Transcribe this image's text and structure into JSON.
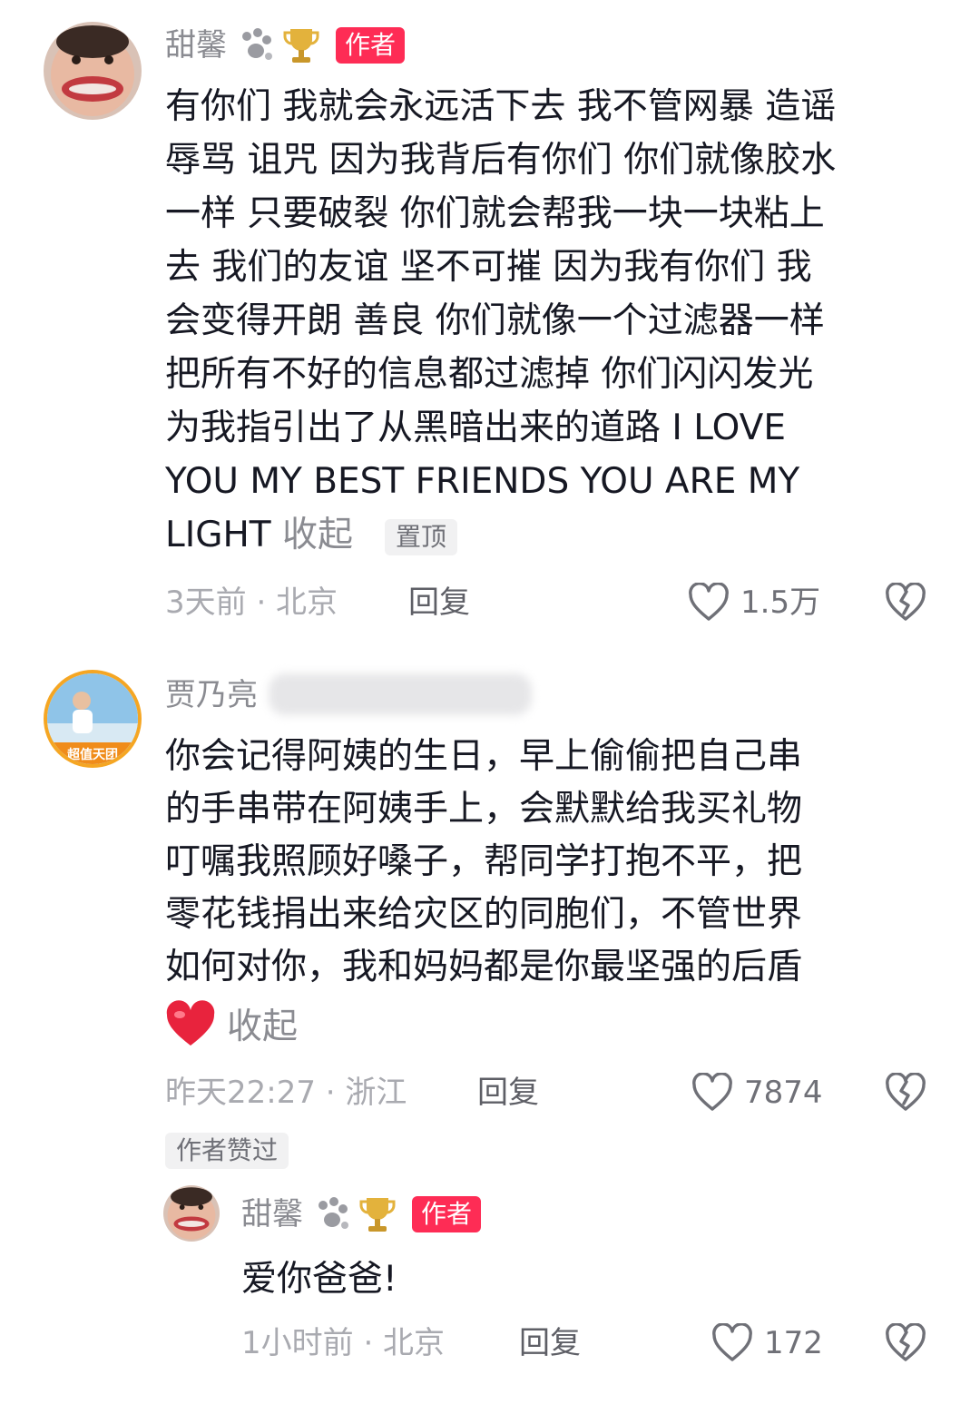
{
  "comment1": {
    "username": "甜馨",
    "author_badge": "作者",
    "lines": [
      "有你们 我就会永远活下去 我不管网暴 造谣",
      "辱骂 诅咒 因为我背后有你们 你们就像胶水",
      "一样 只要破裂 你们就会帮我一块一块粘上",
      "去 我们的友谊 坚不可摧 因为我有你们 我",
      "会变得开朗 善良 你们就像一个过滤器一样",
      "把所有不好的信息都过滤掉 你们闪闪发光",
      "为我指引出了从黑暗出来的道路 I LOVE",
      "YOU MY BEST FRIENDS YOU ARE MY"
    ],
    "last_line": "LIGHT",
    "collapse_label": "收起",
    "pinned_label": "置顶",
    "time_location": "3天前 · 北京",
    "reply_label": "回复",
    "like_count": "1.5万"
  },
  "comment2": {
    "username": "贾乃亮",
    "lines": [
      "你会记得阿姨的生日，早上偷偷把自己串",
      "的手串带在阿姨手上，会默默给我买礼物",
      "叮嘱我照顾好嗓子，帮同学打抱不平，把",
      "零花钱捐出来给灾区的同胞们，不管世界",
      "如何对你，我和妈妈都是你最坚强的后盾"
    ],
    "collapse_label": "收起",
    "time_location": "昨天22:27 · 浙江",
    "reply_label": "回复",
    "like_count": "7874",
    "author_liked_label": "作者赞过"
  },
  "reply1": {
    "username": "甜馨",
    "author_badge": "作者",
    "text": "爱你爸爸!",
    "time_location": "1小时前 · 北京",
    "reply_label": "回复",
    "like_count": "172"
  },
  "icons": {
    "paw": "paw-icon",
    "trophy": "trophy-icon",
    "like": "heart-outline-icon",
    "dislike": "broken-heart-icon",
    "red_heart": "red-heart-emoji"
  },
  "colors": {
    "accent": "#fe2c55",
    "muted": "#a9aab0"
  }
}
